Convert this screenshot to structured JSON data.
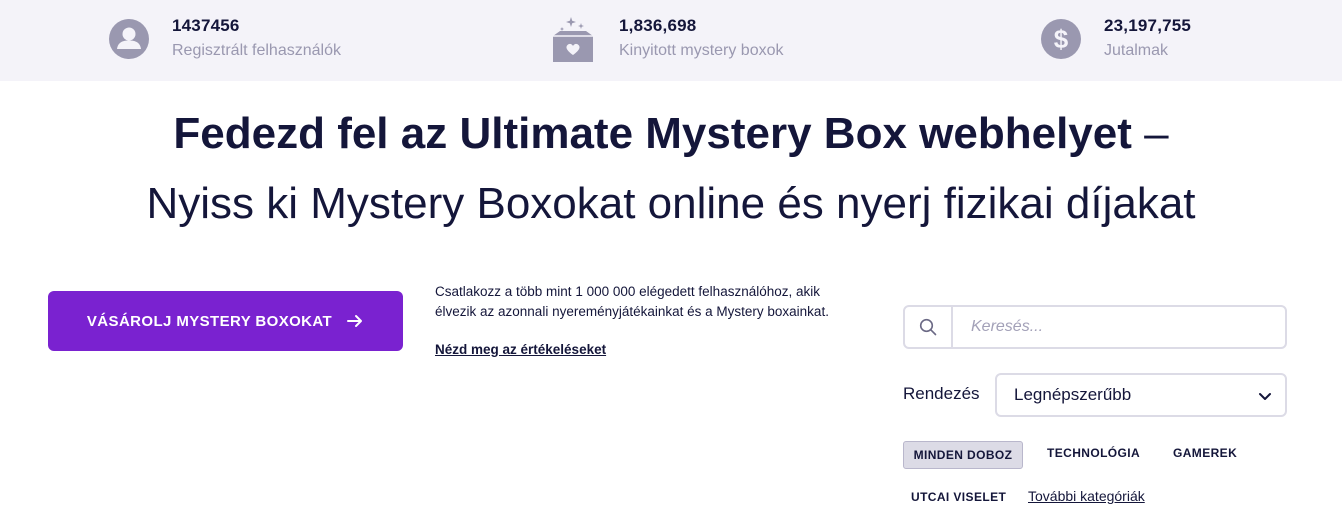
{
  "stats": {
    "users": {
      "value": "1437456",
      "label": "Regisztrált felhasználók",
      "icon": "user-avatar-icon"
    },
    "boxes": {
      "value": "1,836,698",
      "label": "Kinyitott mystery boxok",
      "icon": "mystery-box-icon"
    },
    "rewards": {
      "value": "23,197,755",
      "label": "Jutalmak",
      "icon": "dollar-coin-icon"
    }
  },
  "headline": {
    "bold": "Fedezd fel az Ultimate Mystery Box webhelyet",
    "dash": " –",
    "line2": "Nyiss ki Mystery Boxokat online és nyerj fizikai díjakat"
  },
  "cta": {
    "label": "VÁSÁROLJ MYSTERY BOXOKAT",
    "icon": "arrow-right-icon"
  },
  "join": {
    "text": "Csatlakozz a több mint 1 000 000 elégedett felhasználóhoz, akik élvezik az azonnali nyereményjátékainkat és a Mystery boxainkat.",
    "reviews_link": "Nézd meg az értékeléseket"
  },
  "search": {
    "placeholder": "Keresés...",
    "icon": "search-icon"
  },
  "sort": {
    "label": "Rendezés",
    "selected": "Legnépszerűbb",
    "icon": "chevron-down-icon"
  },
  "categories": {
    "active": "MINDEN DOBOZ",
    "items": [
      "TECHNOLÓGIA",
      "GAMEREK",
      "UTCAI VISELET"
    ],
    "more": "További kategóriák"
  },
  "colors": {
    "stats_bg": "#f4f3f9",
    "icon_gray": "#9a98b0",
    "text_dark": "#14163a",
    "cta_purple": "#7a22d0",
    "border": "#dcdbe6"
  }
}
